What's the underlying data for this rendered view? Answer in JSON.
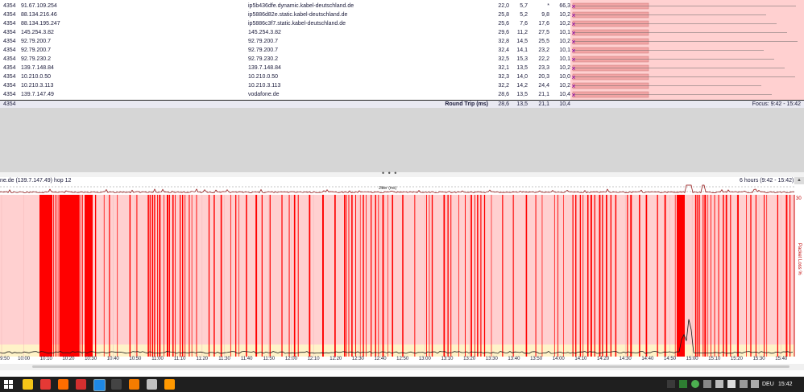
{
  "table": {
    "rows": [
      {
        "count": "4354",
        "ip": "91.67.109.254",
        "name": "ip5b436dfe.dynamic.kabel-deutschland.de",
        "avg": "22,0",
        "min": "5,7",
        "cur": "*",
        "max": "66,3"
      },
      {
        "count": "4354",
        "ip": "88.134.216.46",
        "name": "ip5886d82e.static.kabel-deutschland.de",
        "avg": "25,8",
        "min": "5,2",
        "cur": "9,8",
        "max": "10,2"
      },
      {
        "count": "4354",
        "ip": "88.134.195.247",
        "name": "ip5886c3f7.static.kabel-deutschland.de",
        "avg": "25,6",
        "min": "7,6",
        "cur": "17,6",
        "max": "10,2"
      },
      {
        "count": "4354",
        "ip": "145.254.3.82",
        "name": "145.254.3.82",
        "avg": "29,6",
        "min": "11,2",
        "cur": "27,5",
        "max": "10,1"
      },
      {
        "count": "4354",
        "ip": "92.79.200.7",
        "name": "92.79.200.7",
        "avg": "32,8",
        "min": "14,5",
        "cur": "25,5",
        "max": "10,2"
      },
      {
        "count": "4354",
        "ip": "92.79.200.7",
        "name": "92.79.200.7",
        "avg": "32,4",
        "min": "14,1",
        "cur": "23,2",
        "max": "10,1"
      },
      {
        "count": "4354",
        "ip": "92.79.230.2",
        "name": "92.79.230.2",
        "avg": "32,5",
        "min": "15,3",
        "cur": "22,2",
        "max": "10,1"
      },
      {
        "count": "4354",
        "ip": "139.7.148.84",
        "name": "139.7.148.84",
        "avg": "32,1",
        "min": "13,5",
        "cur": "23,3",
        "max": "10,2"
      },
      {
        "count": "4354",
        "ip": "10.210.0.50",
        "name": "10.210.0.50",
        "avg": "32,3",
        "min": "14,0",
        "cur": "20,3",
        "max": "10,0"
      },
      {
        "count": "4354",
        "ip": "10.210.3.113",
        "name": "10.210.3.113",
        "avg": "32,2",
        "min": "14,2",
        "cur": "24,4",
        "max": "10,2"
      },
      {
        "count": "4354",
        "ip": "139.7.147.49",
        "name": "vodafone.de",
        "avg": "28,6",
        "min": "13,5",
        "cur": "21,1",
        "max": "10,4"
      }
    ],
    "summary": {
      "count": "4354",
      "label": "Round Trip (ms)",
      "avg": "28,6",
      "min": "13,5",
      "cur": "21,1",
      "max": "10,4",
      "focus": "Focus: 9:42 - 15:42"
    }
  },
  "graph": {
    "title": "ne.de (139.7.147.49) hop 12",
    "range": "6 hours (9:42 - 15:42)",
    "jitter_label": "Jitter (ms)",
    "y_right_label": "Packet Loss %",
    "y_right_max": "30",
    "x_ticks": [
      "9:50",
      "10:00",
      "10:10",
      "10:20",
      "10:30",
      "10:40",
      "10:50",
      "11:00",
      "11:10",
      "11:20",
      "11:30",
      "11:40",
      "11:50",
      "12:00",
      "12:10",
      "12:20",
      "12:30",
      "12:40",
      "12:50",
      "13:00",
      "13:10",
      "13:20",
      "13:30",
      "13:40",
      "13:50",
      "14:00",
      "14:10",
      "14:20",
      "14:30",
      "14:40",
      "14:50",
      "15:00",
      "15:10",
      "15:20",
      "15:30",
      "15:40"
    ],
    "colors": {
      "loss": "#ff0000",
      "background": "#ffd0d0",
      "baseline": "#fff3c8",
      "latency": "#1a1a1a"
    }
  },
  "taskbar": {
    "apps": [
      "file-explorer-icon",
      "chrome-icon",
      "firefox-icon",
      "pdf-icon",
      "photo-icon",
      "app-icon",
      "antivirus-icon",
      "tool-icon",
      "vlc-icon"
    ],
    "lang": "DEU",
    "clock": "15:42"
  }
}
